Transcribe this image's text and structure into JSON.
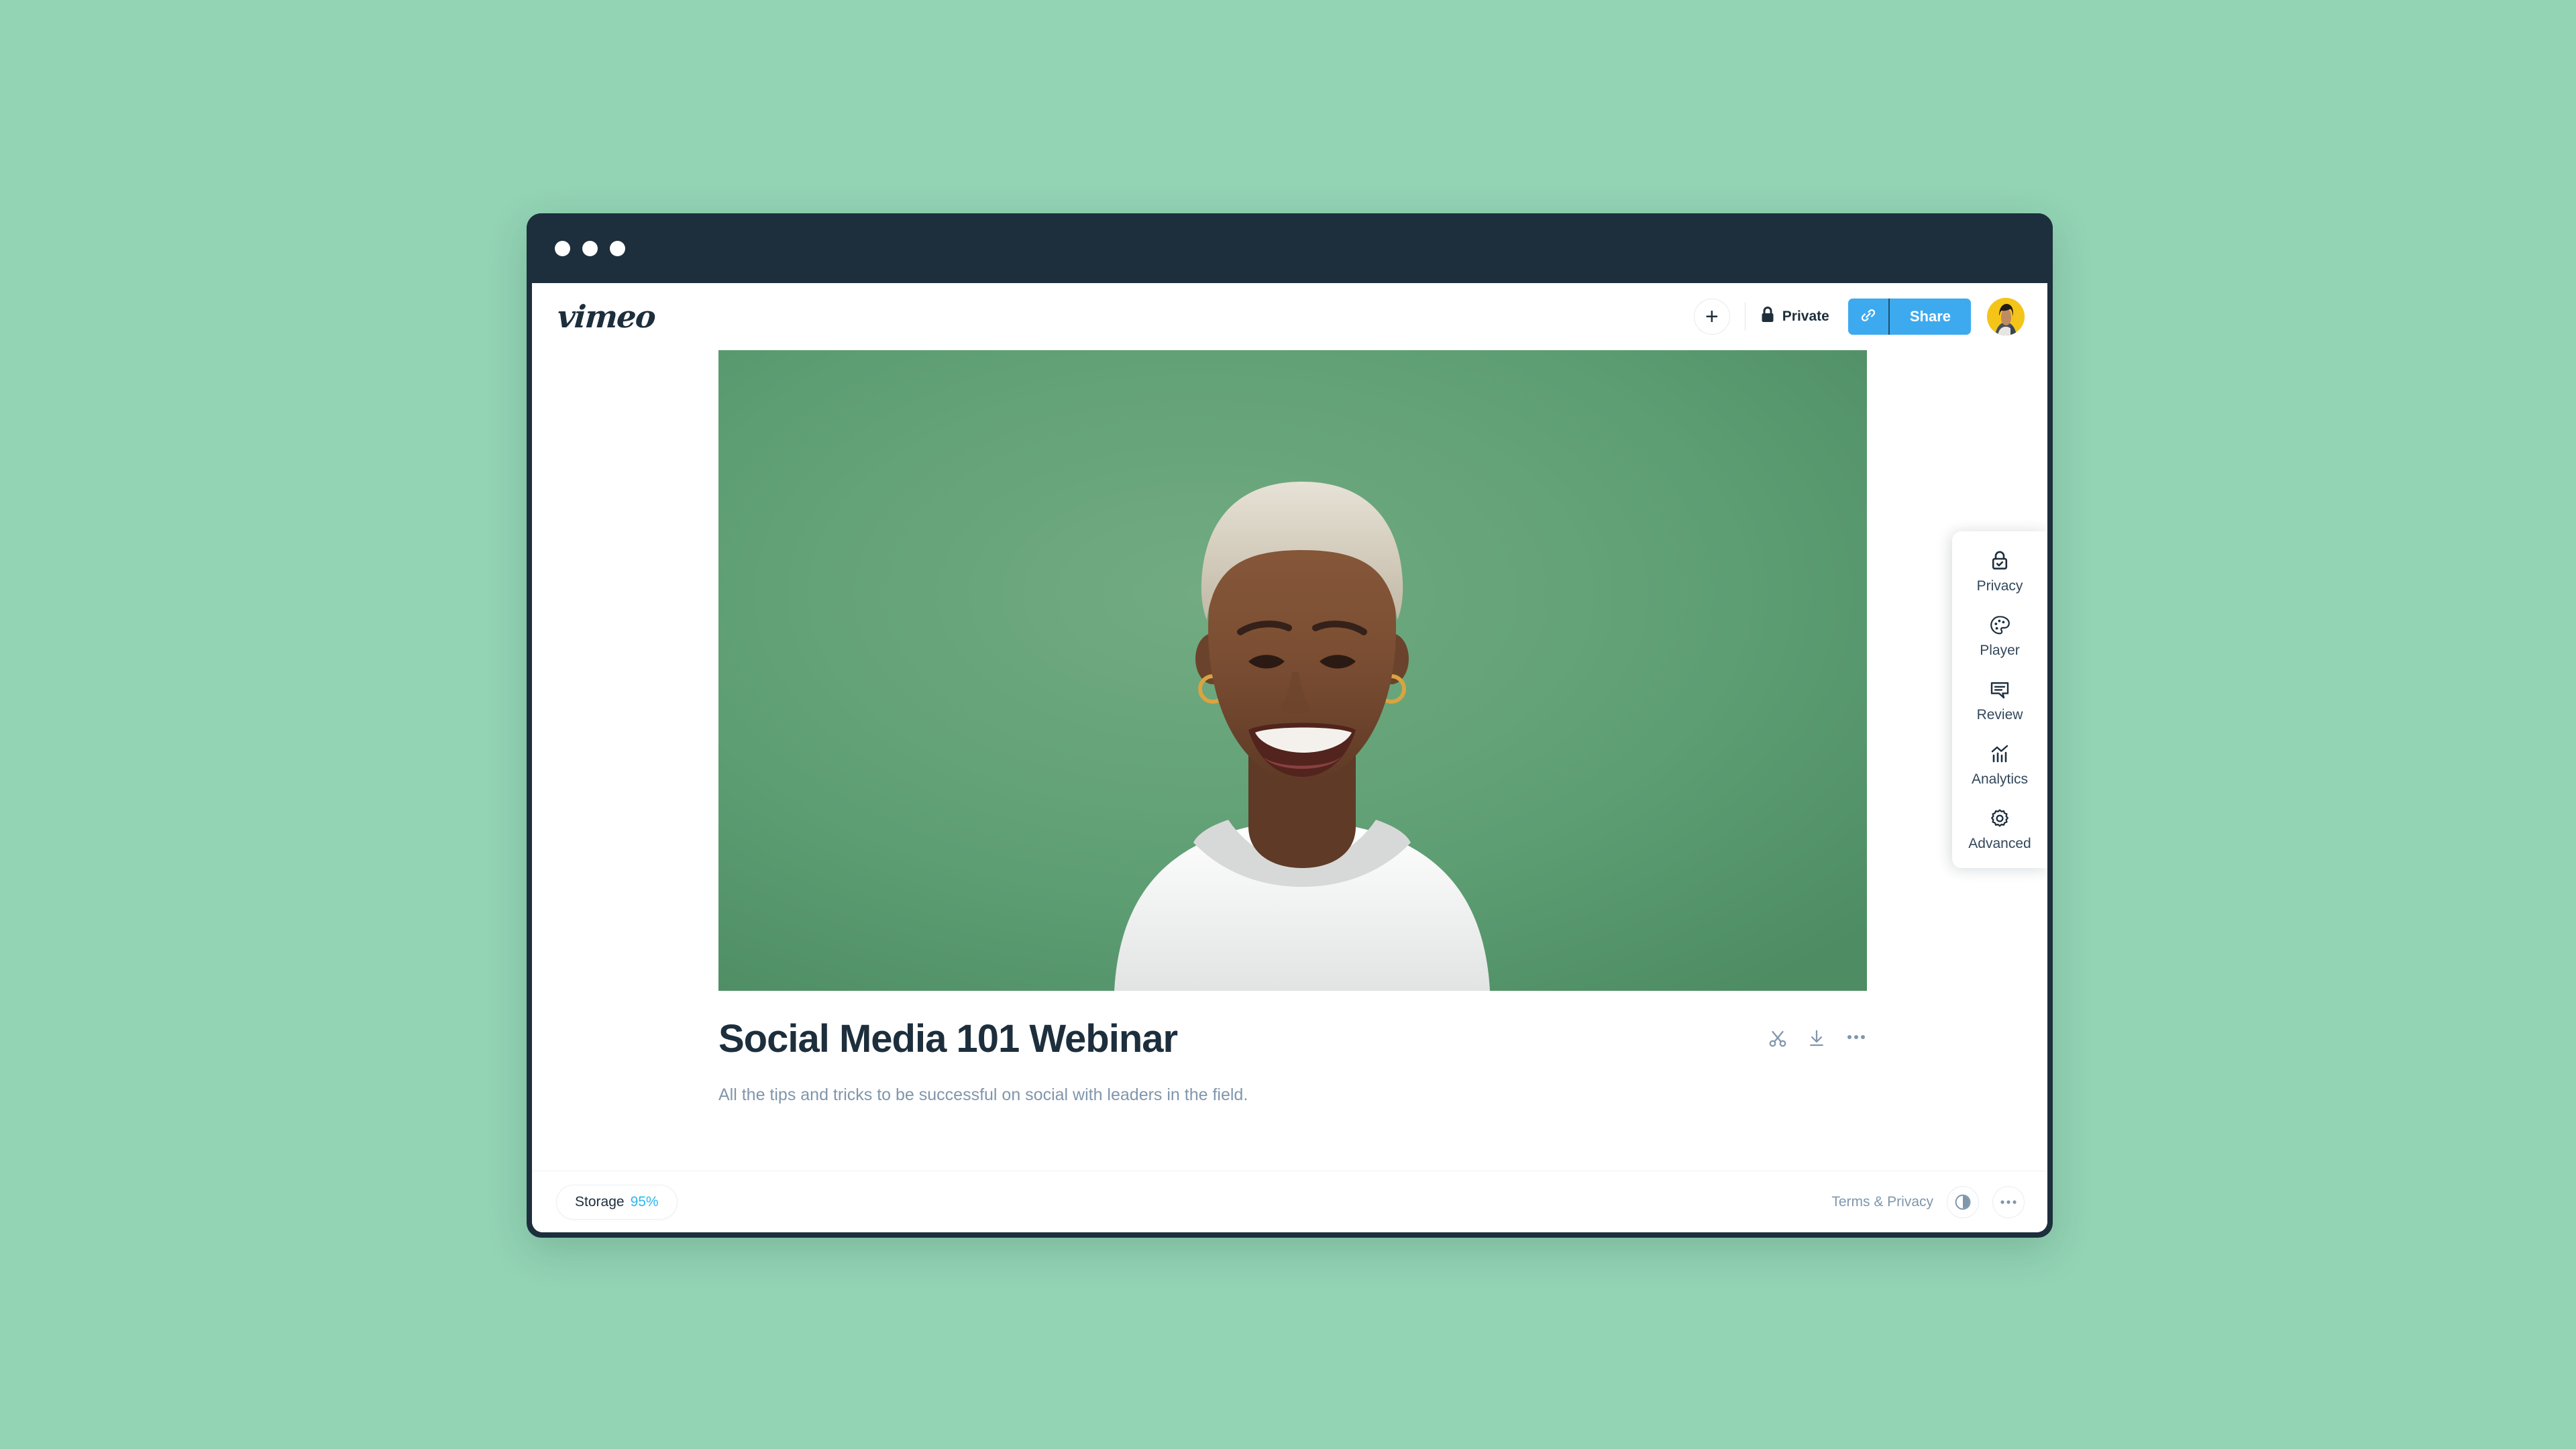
{
  "background_color": "#93d4b5",
  "window": {
    "chrome_color": "#1d2e3c",
    "traffic_lights": [
      "window-dot-1",
      "window-dot-2",
      "window-dot-3"
    ]
  },
  "header": {
    "logo_text": "vimeo",
    "add_label": "+",
    "privacy_label": "Private",
    "privacy_icon": "lock-icon",
    "copy_link_icon": "link-icon",
    "share_label": "Share",
    "share_color": "#3daaef",
    "avatar_icon": "user-avatar"
  },
  "video": {
    "thumbnail_alt": "portrait of smiling woman on green background",
    "background_color": "#5e9e73",
    "title": "Social Media 101 Webinar",
    "description": "All the tips and tricks to be successful on social with leaders in the field.",
    "actions": [
      {
        "name": "trim-video",
        "icon": "scissors-icon"
      },
      {
        "name": "download-video",
        "icon": "download-icon"
      },
      {
        "name": "more-options",
        "icon": "ellipsis-icon"
      }
    ]
  },
  "settings_rail": {
    "items": [
      {
        "label": "Privacy",
        "icon": "lock-check-icon"
      },
      {
        "label": "Player",
        "icon": "palette-icon"
      },
      {
        "label": "Review",
        "icon": "comment-icon"
      },
      {
        "label": "Analytics",
        "icon": "bar-chart-icon"
      },
      {
        "label": "Advanced",
        "icon": "gear-icon"
      }
    ]
  },
  "footer": {
    "storage_label": "Storage",
    "storage_value": "95%",
    "storage_value_color": "#2bb8f0",
    "terms_label": "Terms & Privacy",
    "contrast_icon": "contrast-circle-icon",
    "more_icon": "ellipsis-circle-icon"
  }
}
